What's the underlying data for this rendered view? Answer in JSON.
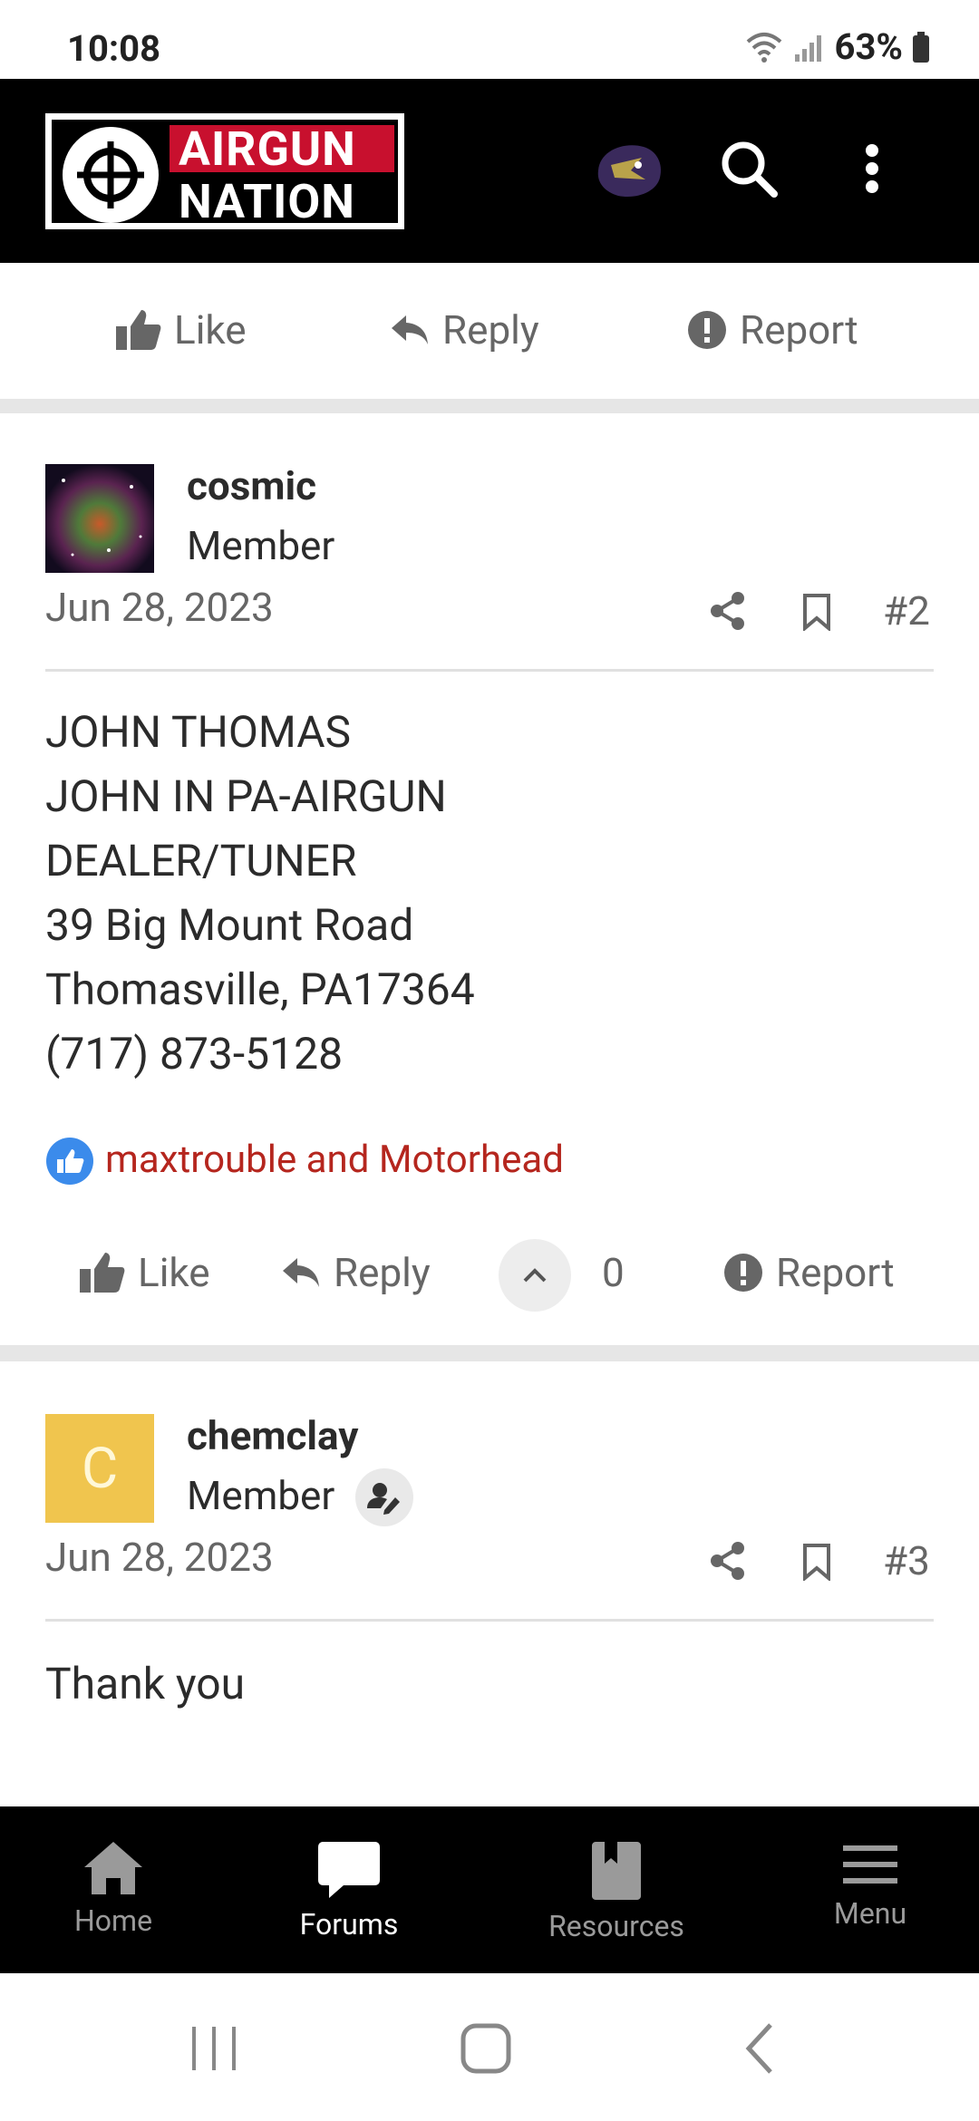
{
  "status_bar": {
    "time": "10:08",
    "battery": "63%"
  },
  "header": {
    "logo_line1": "AIRGUN",
    "logo_line2": "NATION",
    "icons": [
      "user-avatar",
      "search-icon",
      "more-vert-icon"
    ]
  },
  "post1_actions": {
    "like": "Like",
    "reply": "Reply",
    "report": "Report"
  },
  "post2": {
    "username": "cosmic",
    "role": "Member",
    "date": "Jun 28, 2023",
    "number": "#2",
    "lines": [
      "JOHN THOMAS",
      "JOHN IN PA-AIRGUN",
      "DEALER/TUNER",
      "39 Big Mount Road",
      "Thomasville, PA17364",
      "(717) 873-5128"
    ],
    "reactions": "maxtrouble and Motorhead",
    "actions": {
      "like": "Like",
      "reply": "Reply",
      "votes": "0",
      "report": "Report"
    }
  },
  "post3": {
    "avatar_letter": "C",
    "username": "chemclay",
    "role": "Member",
    "date": "Jun 28, 2023",
    "number": "#3",
    "body": "Thank you"
  },
  "bottom_nav": {
    "home": "Home",
    "forums": "Forums",
    "resources": "Resources",
    "menu": "Menu"
  },
  "colors": {
    "brand_red": "#c8102e",
    "link_red": "#b5261e",
    "avatar_yellow": "#f0c54e"
  }
}
